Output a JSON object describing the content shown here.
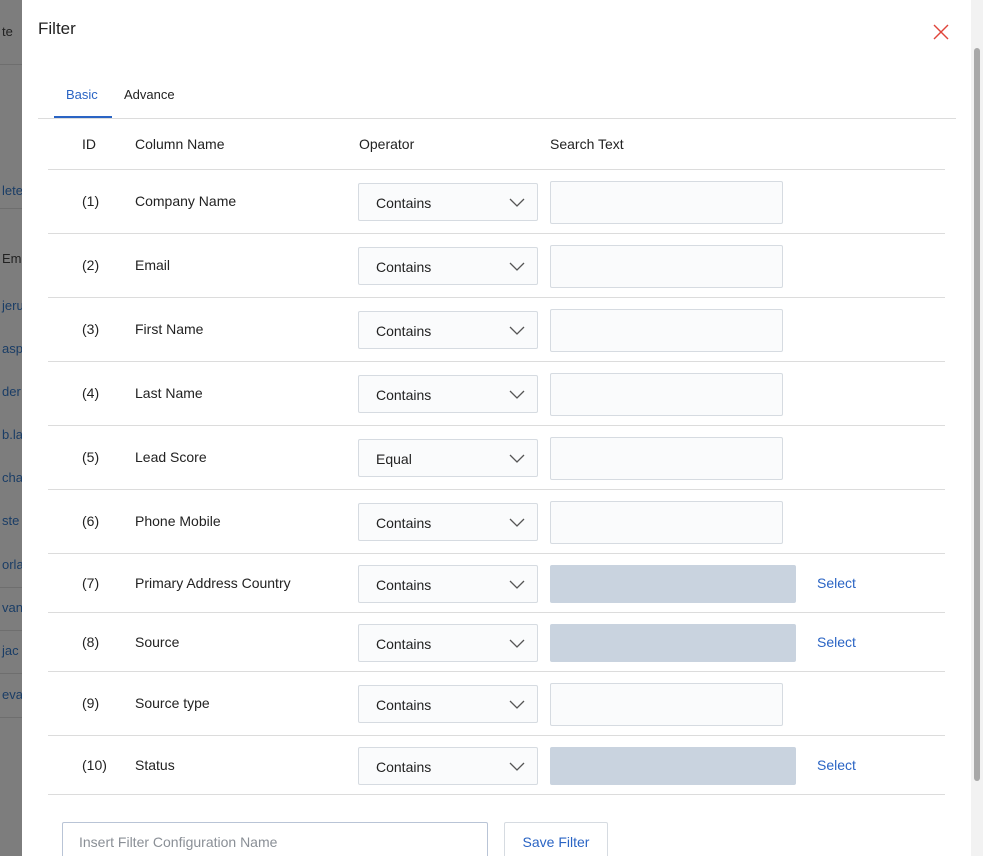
{
  "background": {
    "items": [
      {
        "text": "te",
        "tone": "dark"
      },
      {
        "text": "lete",
        "tone": "link"
      },
      {
        "text": "Em",
        "tone": "dark"
      },
      {
        "text": "jeru",
        "tone": "link"
      },
      {
        "text": "asp",
        "tone": "link"
      },
      {
        "text": "der",
        "tone": "link"
      },
      {
        "text": "b.la",
        "tone": "link"
      },
      {
        "text": "cha",
        "tone": "link"
      },
      {
        "text": "ste",
        "tone": "link"
      },
      {
        "text": "orla",
        "tone": "link"
      },
      {
        "text": "van",
        "tone": "link"
      },
      {
        "text": "jac",
        "tone": "link"
      },
      {
        "text": "eva",
        "tone": "link"
      }
    ]
  },
  "modal": {
    "title": "Filter",
    "close_icon": "close-icon",
    "tabs": [
      {
        "label": "Basic",
        "active": true
      },
      {
        "label": "Advance",
        "active": false
      }
    ],
    "table": {
      "headers": {
        "id": "ID",
        "column_name": "Column Name",
        "operator": "Operator",
        "search_text": "Search Text"
      },
      "rows": [
        {
          "id": "(1)",
          "column_name": "Company Name",
          "operator": "Contains",
          "search_type": "text",
          "search_value": "",
          "select_label": ""
        },
        {
          "id": "(2)",
          "column_name": "Email",
          "operator": "Contains",
          "search_type": "text",
          "search_value": "",
          "select_label": ""
        },
        {
          "id": "(3)",
          "column_name": "First Name",
          "operator": "Contains",
          "search_type": "text",
          "search_value": "",
          "select_label": ""
        },
        {
          "id": "(4)",
          "column_name": "Last Name",
          "operator": "Contains",
          "search_type": "text",
          "search_value": "",
          "select_label": ""
        },
        {
          "id": "(5)",
          "column_name": "Lead Score",
          "operator": "Equal",
          "search_type": "text",
          "search_value": "",
          "select_label": ""
        },
        {
          "id": "(6)",
          "column_name": "Phone Mobile",
          "operator": "Contains",
          "search_type": "text",
          "search_value": "",
          "select_label": ""
        },
        {
          "id": "(7)",
          "column_name": "Primary Address Country",
          "operator": "Contains",
          "search_type": "select",
          "search_value": "",
          "select_label": "Select"
        },
        {
          "id": "(8)",
          "column_name": "Source",
          "operator": "Contains",
          "search_type": "select",
          "search_value": "",
          "select_label": "Select"
        },
        {
          "id": "(9)",
          "column_name": "Source type",
          "operator": "Contains",
          "search_type": "text",
          "search_value": "",
          "select_label": ""
        },
        {
          "id": "(10)",
          "column_name": "Status",
          "operator": "Contains",
          "search_type": "select",
          "search_value": "",
          "select_label": "Select"
        }
      ]
    },
    "footer": {
      "config_name_placeholder": "Insert Filter Configuration Name",
      "config_name_value": "",
      "save_label": "Save Filter"
    }
  },
  "colors": {
    "accent": "#2a64c4",
    "close": "#e0443a",
    "disabled_field": "#c9d3df"
  }
}
